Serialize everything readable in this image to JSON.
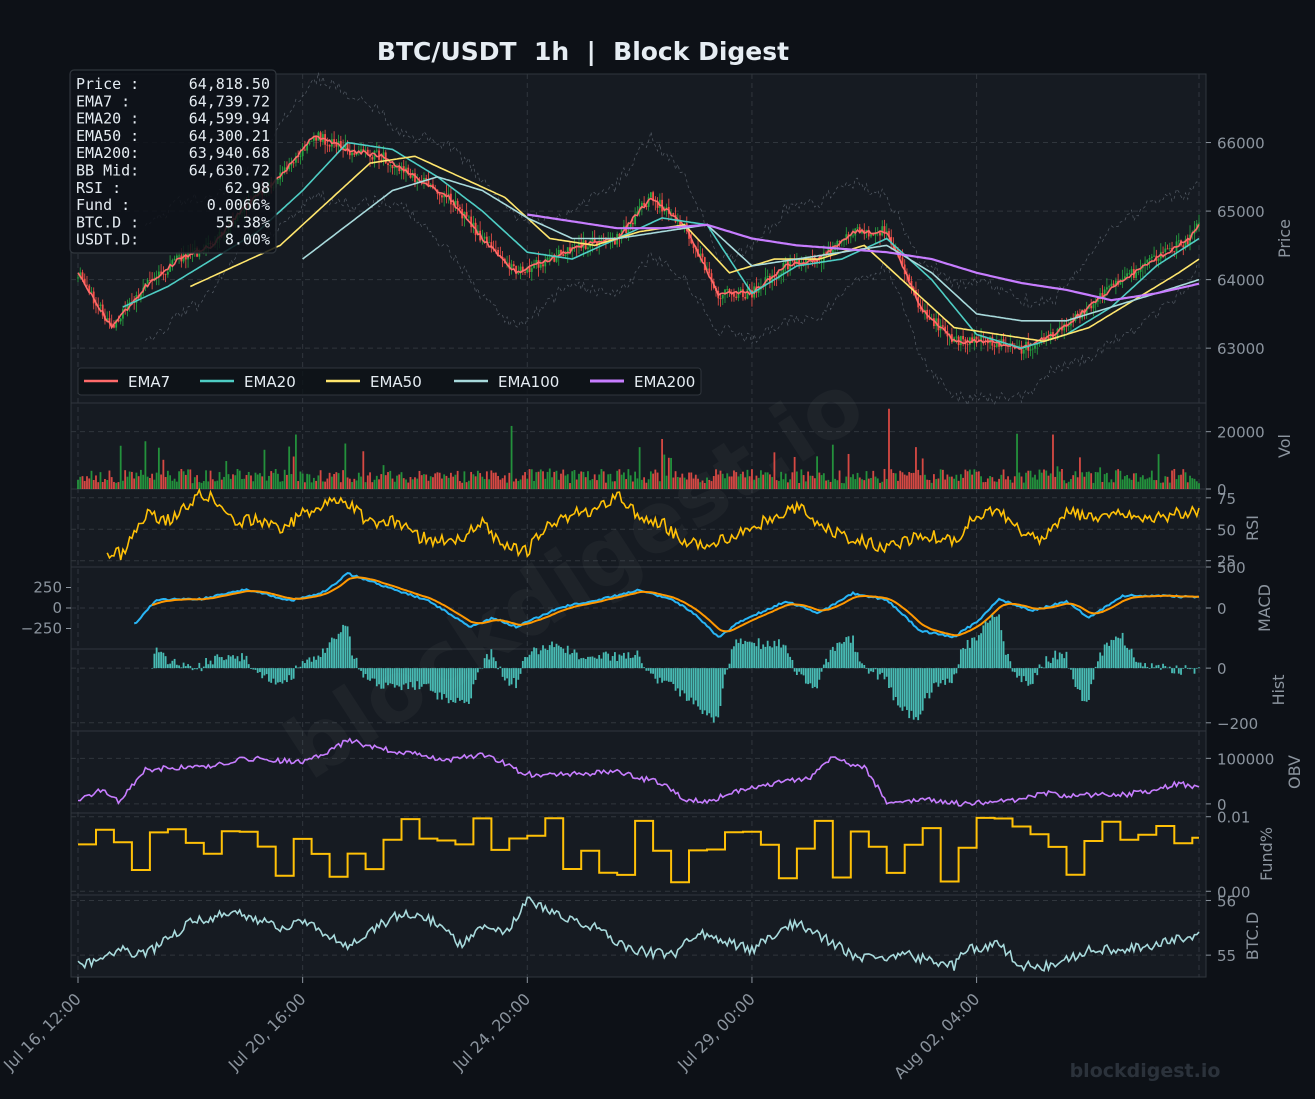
{
  "title": "BTC/USDT  1h  |  Block Digest",
  "watermark": "blockdigest.io",
  "footer_brand": "blockdigest.io",
  "colors": {
    "background": "#0d1117",
    "panel": "#161b22",
    "grid": "#30363d",
    "text": "#8b949e",
    "title": "#e6edf3",
    "up": "#26a641",
    "down": "#f85149",
    "ema7": "#ff6b6b",
    "ema20": "#4ecdc4",
    "ema50": "#ffe66d",
    "ema100": "#a8dadc",
    "ema200": "#c77dff",
    "rsi": "#ffc107",
    "macd": "#29b6f6",
    "signal": "#ff9800",
    "hist": "#4ecdc4",
    "obv": "#c77dff",
    "fund": "#ffc107",
    "btcd": "#a8dadc"
  },
  "info_box": [
    {
      "label": "Price :",
      "value": "64,818.50"
    },
    {
      "label": "EMA7  :",
      "value": "64,739.72"
    },
    {
      "label": "EMA20 :",
      "value": "64,599.94"
    },
    {
      "label": "EMA50 :",
      "value": "64,300.21"
    },
    {
      "label": "EMA200:",
      "value": "63,940.68"
    },
    {
      "label": "BB Mid:",
      "value": "64,630.72"
    },
    {
      "label": "RSI   :",
      "value": "62.98"
    },
    {
      "label": "Fund  :",
      "value": "0.0066%"
    },
    {
      "label": "BTC.D :",
      "value": "55.38%"
    },
    {
      "label": "USDT.D:",
      "value": "8.00%"
    }
  ],
  "legend": [
    "EMA7",
    "EMA20",
    "EMA50",
    "EMA100",
    "EMA200"
  ],
  "x_ticks": [
    "Jul 16, 12:00",
    "Jul 20, 16:00",
    "Jul 24, 20:00",
    "Jul 29, 00:00",
    "Aug 02, 04:00"
  ],
  "panels": [
    {
      "id": "price",
      "ylabel": "Price",
      "ticks": [
        {
          "v": 63000,
          "t": "63000"
        },
        {
          "v": 64000,
          "t": "64000"
        },
        {
          "v": 65000,
          "t": "65000"
        },
        {
          "v": 66000,
          "t": "66000"
        }
      ]
    },
    {
      "id": "vol",
      "ylabel": "Vol",
      "ticks": [
        {
          "v": 0,
          "t": "0"
        },
        {
          "v": 20000,
          "t": "20000"
        }
      ]
    },
    {
      "id": "rsi",
      "ylabel": "RSI",
      "ticks": [
        {
          "v": 25,
          "t": "25"
        },
        {
          "v": 50,
          "t": "50"
        },
        {
          "v": 75,
          "t": "75"
        }
      ]
    },
    {
      "id": "macd",
      "ylabel": "MACD",
      "ticks": [
        {
          "v": 0,
          "t": "0"
        },
        {
          "v": 500,
          "t": "500"
        }
      ],
      "left_ticks": [
        {
          "v": 250,
          "t": "250"
        },
        {
          "v": 0,
          "t": "0"
        },
        {
          "v": -250,
          "t": "−250"
        }
      ]
    },
    {
      "id": "hist",
      "ylabel": "Hist",
      "ticks": [
        {
          "v": 0,
          "t": "0"
        },
        {
          "v": -200,
          "t": "−200"
        }
      ]
    },
    {
      "id": "obv",
      "ylabel": "OBV",
      "ticks": [
        {
          "v": 0,
          "t": "0"
        },
        {
          "v": 100000,
          "t": "100000"
        }
      ]
    },
    {
      "id": "fund",
      "ylabel": "Fund%",
      "ticks": [
        {
          "v": 0.0,
          "t": "0.00"
        },
        {
          "v": 0.01,
          "t": "0.01"
        }
      ]
    },
    {
      "id": "btcd",
      "ylabel": "BTC.D",
      "ticks": [
        {
          "v": 55,
          "t": "55"
        },
        {
          "v": 56,
          "t": "56"
        }
      ]
    }
  ],
  "chart_data": {
    "type": "line",
    "title": "BTC/USDT  1h  |  Block Digest",
    "x_ticks": [
      "Jul 16, 12:00",
      "Jul 20, 16:00",
      "Jul 24, 20:00",
      "Jul 29, 00:00",
      "Aug 02, 04:00"
    ],
    "note_x": "x values are hourly-bar positions; 100 bars between tick labels",
    "price_series": [
      {
        "name": "EMA7",
        "x": [
          0,
          15,
          30,
          45,
          60,
          75,
          90,
          105,
          120,
          135,
          150,
          165,
          180,
          195,
          210,
          225,
          240,
          255,
          270,
          285,
          300,
          315,
          330,
          345,
          360,
          375,
          390,
          405,
          420,
          435,
          450,
          465,
          480,
          495,
          499
        ],
        "values": [
          64100,
          63300,
          63900,
          64300,
          64500,
          65100,
          65500,
          66100,
          65900,
          65800,
          65500,
          65200,
          64600,
          64100,
          64300,
          64500,
          64600,
          65200,
          64800,
          63800,
          63800,
          64200,
          64300,
          64700,
          64700,
          63600,
          63100,
          63100,
          63000,
          63200,
          63600,
          64000,
          64300,
          64600,
          64800
        ]
      },
      {
        "name": "EMA20",
        "x": [
          20,
          40,
          60,
          80,
          100,
          120,
          140,
          160,
          180,
          200,
          220,
          240,
          260,
          280,
          300,
          320,
          340,
          360,
          380,
          400,
          420,
          440,
          460,
          480,
          499
        ],
        "values": [
          63600,
          63900,
          64300,
          64700,
          65300,
          66000,
          65900,
          65500,
          65000,
          64400,
          64300,
          64600,
          64900,
          64800,
          63800,
          64200,
          64300,
          64600,
          64000,
          63200,
          63000,
          63200,
          63600,
          64200,
          64600
        ]
      },
      {
        "name": "EMA50",
        "x": [
          50,
          70,
          90,
          110,
          130,
          150,
          170,
          190,
          210,
          230,
          250,
          270,
          290,
          310,
          330,
          350,
          370,
          390,
          410,
          430,
          450,
          470,
          490,
          499
        ],
        "values": [
          63900,
          64200,
          64500,
          65100,
          65700,
          65800,
          65500,
          65200,
          64600,
          64500,
          64700,
          64800,
          64100,
          64300,
          64300,
          64500,
          63900,
          63300,
          63200,
          63100,
          63300,
          63700,
          64100,
          64300
        ]
      },
      {
        "name": "EMA100",
        "x": [
          100,
          120,
          140,
          160,
          180,
          200,
          220,
          240,
          260,
          280,
          300,
          320,
          340,
          360,
          380,
          400,
          420,
          440,
          460,
          480,
          499
        ],
        "values": [
          64300,
          64800,
          65300,
          65500,
          65300,
          64900,
          64600,
          64600,
          64700,
          64800,
          64200,
          64300,
          64400,
          64500,
          64100,
          63500,
          63400,
          63400,
          63600,
          63800,
          64000
        ]
      },
      {
        "name": "EMA200",
        "x": [
          200,
          220,
          240,
          260,
          280,
          300,
          320,
          340,
          360,
          380,
          400,
          420,
          440,
          460,
          480,
          499
        ],
        "values": [
          64950,
          64850,
          64750,
          64750,
          64800,
          64600,
          64500,
          64450,
          64400,
          64300,
          64100,
          63950,
          63850,
          63700,
          63800,
          63940
        ]
      }
    ],
    "ylim_price": [
      62200,
      67000
    ],
    "ylim_vol": [
      0,
      30000
    ],
    "ylim_rsi": [
      20,
      82
    ],
    "ylim_macd": [
      -500,
      500
    ],
    "ylim_hist": [
      -230,
      70
    ],
    "ylim_obv": [
      -20000,
      160000
    ],
    "ylim_fund": [
      -0.0005,
      0.0105
    ],
    "ylim_btcd": [
      54.6,
      56.1
    ],
    "legend_position": "lower-left",
    "grid": true
  }
}
